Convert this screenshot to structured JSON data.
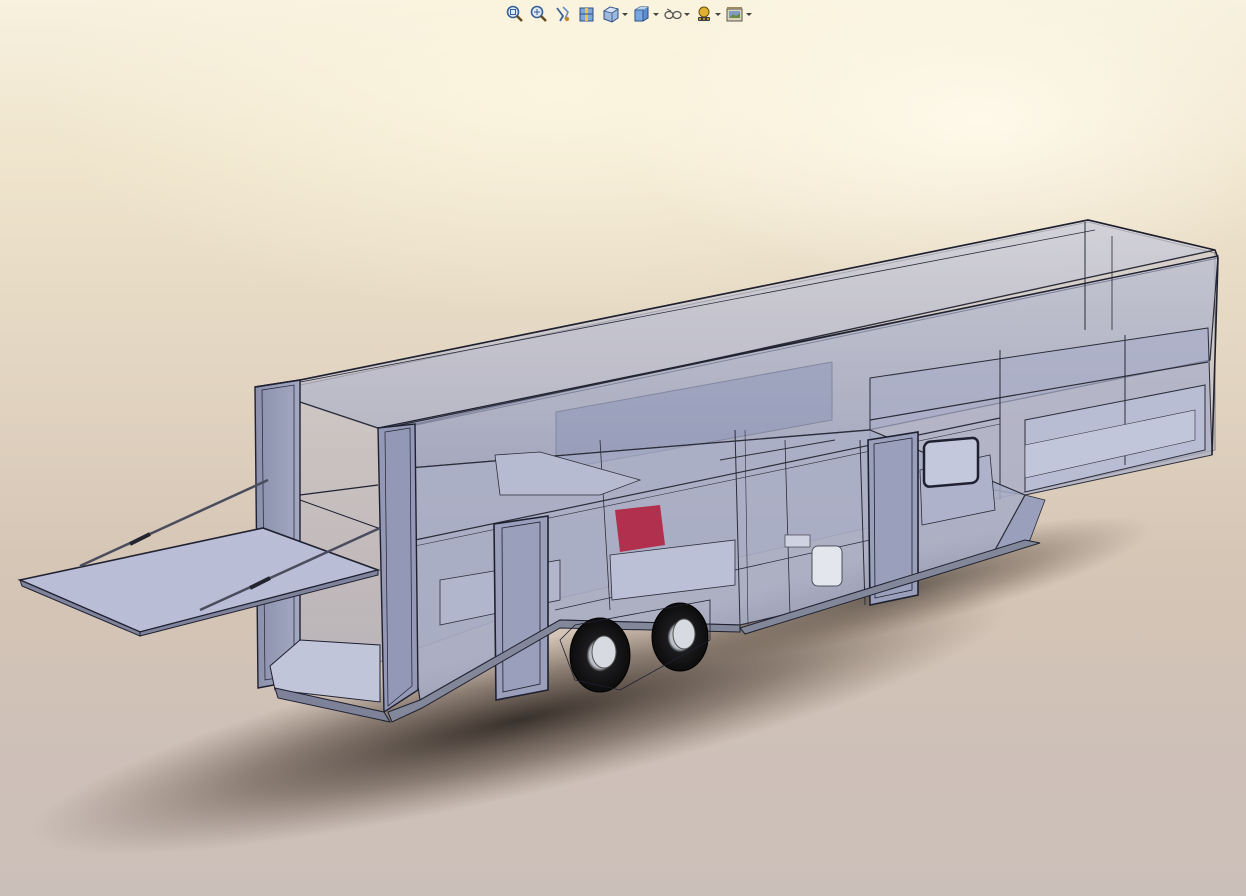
{
  "toolbar": {
    "buttons": [
      {
        "icon": "zoom-to-fit-icon",
        "dropdown": false
      },
      {
        "icon": "zoom-to-area-icon",
        "dropdown": false
      },
      {
        "icon": "previous-view-icon",
        "dropdown": false
      },
      {
        "icon": "section-view-icon",
        "dropdown": false
      },
      {
        "icon": "view-orientation-icon",
        "dropdown": true
      },
      {
        "icon": "display-style-icon",
        "dropdown": true
      },
      {
        "icon": "hide-show-items-icon",
        "dropdown": true
      },
      {
        "icon": "edit-appearance-icon",
        "dropdown": true
      },
      {
        "icon": "apply-scene-icon",
        "dropdown": true
      }
    ]
  },
  "colors": {
    "icon_blue": "#4a78b8",
    "model_fill": "#9ea3bc",
    "model_edge": "#2b2d3a",
    "glass": "#b9bfd6",
    "accent_red": "#a8324a"
  }
}
